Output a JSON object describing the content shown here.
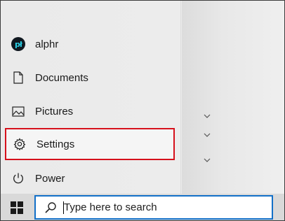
{
  "start_menu": {
    "user": {
      "avatar_text": "pł",
      "name": "alphr"
    },
    "items": [
      {
        "label": "Documents",
        "icon": "document-icon"
      },
      {
        "label": "Pictures",
        "icon": "pictures-icon"
      },
      {
        "label": "Settings",
        "icon": "gear-icon",
        "highlighted": true
      },
      {
        "label": "Power",
        "icon": "power-icon"
      }
    ]
  },
  "taskbar": {
    "search": {
      "placeholder": "Type here to search",
      "value": ""
    }
  },
  "colors": {
    "highlight_border": "#d6111c",
    "search_border": "#1270c8",
    "avatar_accent": "#2ad0e6"
  }
}
